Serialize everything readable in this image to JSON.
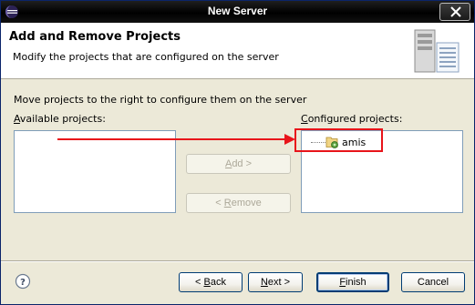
{
  "window": {
    "title": "New Server"
  },
  "header": {
    "title": "Add and Remove Projects",
    "description": "Modify the projects that are configured on the server"
  },
  "body": {
    "instruction": "Move projects to the right to configure them on the server",
    "available_label_accel": "A",
    "available_label_rest": "vailable projects:",
    "configured_label_accel": "C",
    "configured_label_rest": "onfigured projects:",
    "configured_items": [
      {
        "label": "amis"
      }
    ]
  },
  "buttons": {
    "add": {
      "accel": "A",
      "rest": "dd >"
    },
    "remove": {
      "prefix": "< ",
      "accel": "R",
      "rest": "emove"
    },
    "back": {
      "prefix": "< ",
      "accel": "B",
      "rest": "ack"
    },
    "next": {
      "accel": "N",
      "rest": "ext >"
    },
    "finish": {
      "accel": "F",
      "rest": "inish"
    },
    "cancel": "Cancel"
  },
  "colors": {
    "highlight": "#e8141a"
  }
}
